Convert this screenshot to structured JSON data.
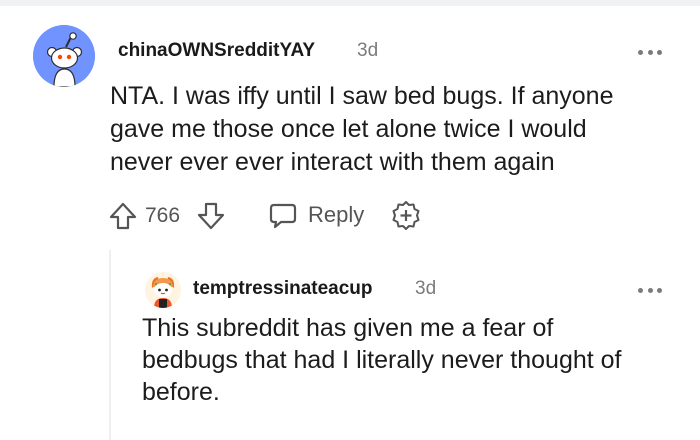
{
  "comments": [
    {
      "author": "chinaOWNSredditYAY",
      "age": "3d",
      "avatar_icon": "snoo-avatar-icon",
      "avatar_color": "#7193ff",
      "body_lines": [
        "NTA. I was iffy until I saw bed bugs. If anyone",
        "gave me those once let alone twice I would",
        "never ever ever interact with them again"
      ],
      "score": "766",
      "reply_label": "Reply"
    },
    {
      "author": "temptressinateacup",
      "age": "3d",
      "avatar_icon": "custom-avatar-icon",
      "body_lines": [
        "This subreddit has given me a fear of",
        "bedbugs that had I literally never thought of",
        "before."
      ]
    }
  ],
  "icons": {
    "upvote": "upvote-arrow-icon",
    "downvote": "downvote-arrow-icon",
    "reply": "speech-bubble-icon",
    "award": "award-plus-icon",
    "more": "more-options-icon"
  },
  "colors": {
    "text": "#1c1c1c",
    "muted": "#787c7e",
    "action": "#555555",
    "thread_line": "#edeff1"
  }
}
